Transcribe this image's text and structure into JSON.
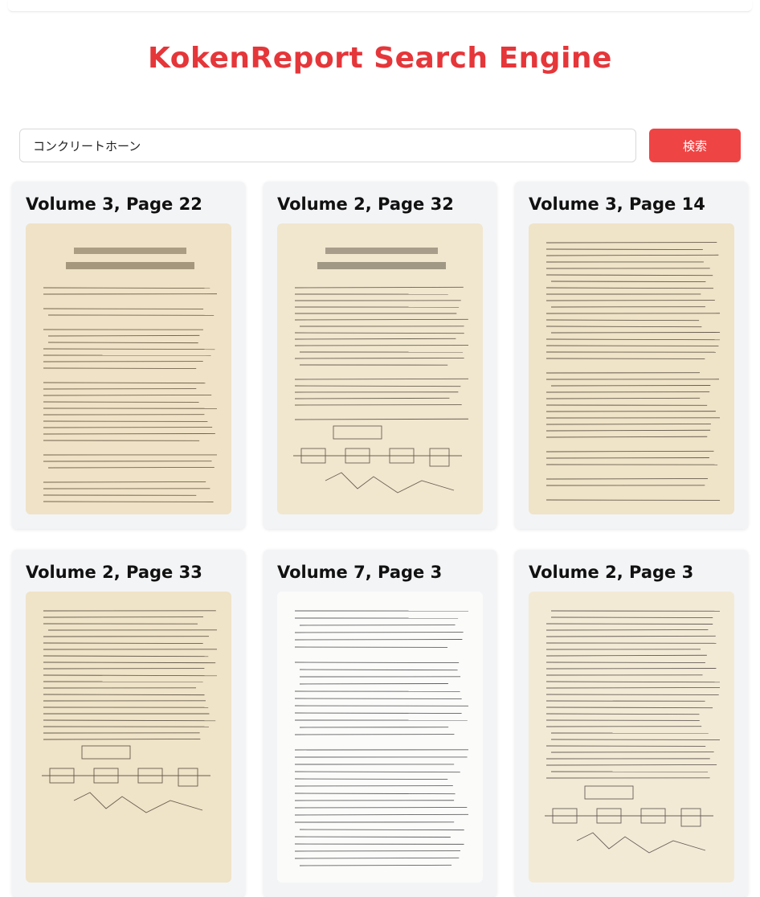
{
  "app": {
    "title": "KokenReport Search Engine"
  },
  "search": {
    "value": "コンクリートホーン",
    "button_label": "検索"
  },
  "results": [
    {
      "title": "Volume 3, Page 22",
      "paper": "#efe2c6",
      "ink": "#4a3b26"
    },
    {
      "title": "Volume 2, Page 32",
      "paper": "#f1e7cf",
      "ink": "#3e3428"
    },
    {
      "title": "Volume 3, Page 14",
      "paper": "#efe3c8",
      "ink": "#3c3128"
    },
    {
      "title": "Volume 2, Page 33",
      "paper": "#efe3c8",
      "ink": "#3a3026"
    },
    {
      "title": "Volume 7, Page 3",
      "paper": "#fbfbfa",
      "ink": "#2e2e2e"
    },
    {
      "title": "Volume 2, Page 3",
      "paper": "#f3ead6",
      "ink": "#3a3030"
    }
  ]
}
